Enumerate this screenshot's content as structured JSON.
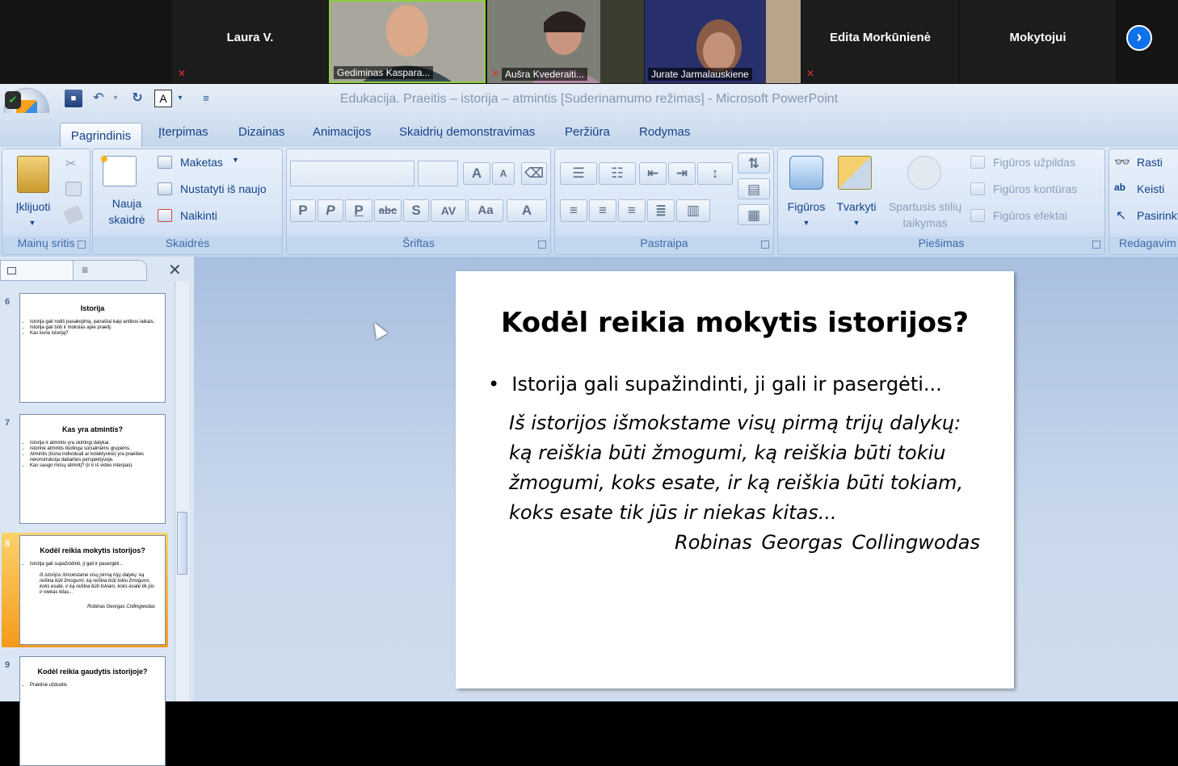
{
  "zoom": {
    "participants": [
      {
        "name": "Laura V.",
        "muted": true
      },
      {
        "name": "Gediminas Kaspara...",
        "muted": false
      },
      {
        "name": "Aušra Kvederaiti...",
        "muted": true
      },
      {
        "name": "Jurate Jarmalauskiene",
        "muted": false
      },
      {
        "name": "Edita Morkūnienė",
        "muted": true
      },
      {
        "name": "Mokytojui",
        "muted": false
      }
    ],
    "next_icon": "chevron-right-icon"
  },
  "window": {
    "title": "Edukacija. Praeitis – istorija – atmintis [Suderinamumo režimas] - Microsoft PowerPoint",
    "font_box": "A"
  },
  "tabs": [
    "Pagrindinis",
    "Įterpimas",
    "Dizainas",
    "Animacijos",
    "Skaidrių demonstravimas",
    "Peržiūra",
    "Rodymas"
  ],
  "ribbon": {
    "clipboard": {
      "paste": "Įklijuoti",
      "label": "Mainų sritis"
    },
    "slides": {
      "new_slide": [
        "Nauja",
        "skaidrė"
      ],
      "layout": "Maketas",
      "reset": "Nustatyti iš naujo",
      "delete": "Naikinti",
      "label": "Skaidrės"
    },
    "font": {
      "label": "Šriftas",
      "buttons": [
        "A",
        "A",
        "P",
        "P",
        "P",
        "abc",
        "S",
        "AV",
        "Aa",
        "A"
      ]
    },
    "paragraph": {
      "label": "Pastraipa"
    },
    "drawing": {
      "shapes": "Figūros",
      "arrange": "Tvarkyti",
      "quick_styles": [
        "Spartusis stilių",
        "taikymas"
      ],
      "fill": "Figūros užpildas",
      "outline": "Figūros kontūras",
      "effects": "Figūros efektai",
      "label": "Piešimas"
    },
    "editing": {
      "find": "Rasti",
      "replace": "Keisti",
      "select": "Pasirinkt",
      "label": "Redagavim"
    }
  },
  "thumbnails": [
    {
      "num": "6",
      "title": "Istorija",
      "bullets": [
        "Istorija gali rodiš pasakojimą, panašiai kaip antikos laikais.",
        "Istorija gali būti ir mokslas apie praeitį.",
        "Kas kuria istoriją?"
      ]
    },
    {
      "num": "7",
      "title": "Kas yra atmintis?",
      "bullets": [
        "Istorija ir atmintis yra skirtingi dalykai.",
        "Istorinė atmintis būdinga socialinėms grupėms.",
        "Atmintis (būna individuali ar kolektyvinė) yra praeities rekonstrukcija dabarties perspektyvoje.",
        "Kas saugo mūsų atmintį? (ir ir iš video interpas)"
      ]
    },
    {
      "num": "8",
      "title": "Kodėl reikia mokytis istorijos?",
      "bullets": [
        "Istorija gali supažindinti, ji gali ir pasergėti..."
      ],
      "quote": "Iš istorijos išmokstame visų pirmą trijų dalykų: ką reiškia būti žmogumi, ką reiškia būti tokiu žmogumi, koks esate, ir ką reiškia būti tokiam, koks esate tik jūs ir niekas kitas...",
      "author": "Robinas Georgas Collingwodas"
    },
    {
      "num": "9",
      "title": "Kodėl reikia gaudytis istorijoje?",
      "bullets": [
        "Praktinė užduotis"
      ]
    }
  ],
  "slide": {
    "title": "Kodėl reikia mokytis istorijos?",
    "bullet": "Istorija gali supažindinti, ji gali ir pasergėti...",
    "quote_lines": [
      "Iš istorijos išmokstame visų pirmą trijų dalykų:",
      "ką reiškia būti žmogumi, ką reiškia būti tokiu",
      "žmogumi, koks esate, ir ką reiškia būti tokiam,",
      "koks esate tik jūs ir niekas kitas..."
    ],
    "author": "Robinas Georgas Collingwodas"
  }
}
